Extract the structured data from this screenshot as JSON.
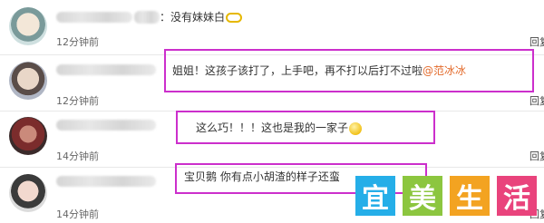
{
  "comments": [
    {
      "text": "：没有妹妹白",
      "time": "12分钟前",
      "reply": "回复"
    },
    {
      "text": "姐姐！这孩子该打了，上手吧，再不打以后打不过啦",
      "mention": "@范冰冰",
      "time": "12分钟前",
      "reply": "回复"
    },
    {
      "text": "这么巧！！！这也是我的一家子",
      "time": "14分钟前",
      "reply": "回复"
    },
    {
      "text": "宝贝鹅 你有点小胡渣的样子还蛮",
      "time": "14分钟前",
      "reply": "回复"
    }
  ],
  "logo": {
    "chars": [
      "宜",
      "美",
      "生",
      "活"
    ]
  },
  "colors": {
    "highlight": "#cc2fcc",
    "mention": "#e36b2c"
  },
  "icons": [
    "glasses-emoji-icon",
    "smile-emoji-icon"
  ]
}
